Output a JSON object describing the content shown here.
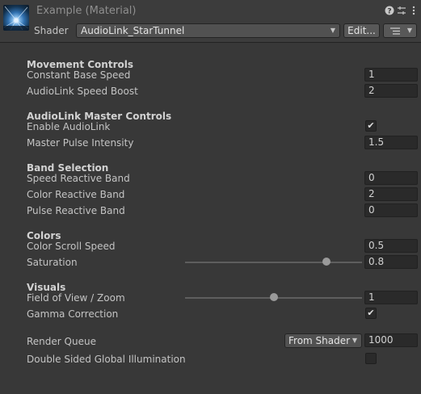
{
  "header": {
    "title": "Example (Material)",
    "shader_label": "Shader",
    "shader_value": "AudioLink_StarTunnel",
    "edit_label": "Edit...",
    "help_icon": "question-circle-icon",
    "settings_icon": "sliders-icon",
    "more_icon": "kebab-menu-icon"
  },
  "sections": {
    "movement": {
      "title": "Movement Controls",
      "base_speed_label": "Constant Base Speed",
      "base_speed_value": "1",
      "speed_boost_label": "AudioLink Speed Boost",
      "speed_boost_value": "2"
    },
    "audiolink": {
      "title": "AudioLink Master Controls",
      "enable_label": "Enable AudioLink",
      "enable_checked": true,
      "pulse_label": "Master Pulse Intensity",
      "pulse_value": "1.5"
    },
    "bands": {
      "title": "Band Selection",
      "speed_label": "Speed Reactive Band",
      "speed_value": "0",
      "color_label": "Color Reactive Band",
      "color_value": "2",
      "pulse_label": "Pulse Reactive Band",
      "pulse_value": "0"
    },
    "colors": {
      "title": "Colors",
      "scroll_label": "Color Scroll Speed",
      "scroll_value": "0.5",
      "saturation_label": "Saturation",
      "saturation_value": "0.8",
      "saturation_slider": 0.8
    },
    "visuals": {
      "title": "Visuals",
      "fov_label": "Field of View / Zoom",
      "fov_value": "1",
      "fov_slider": 0.5,
      "gamma_label": "Gamma Correction",
      "gamma_checked": true
    },
    "render": {
      "queue_label": "Render Queue",
      "queue_mode": "From Shader",
      "queue_value": "1000",
      "dsgi_label": "Double Sided Global Illumination",
      "dsgi_checked": false
    }
  },
  "colors": {
    "background": "#383838",
    "field": "#2a2a2a",
    "text": "#c4c4c4"
  }
}
